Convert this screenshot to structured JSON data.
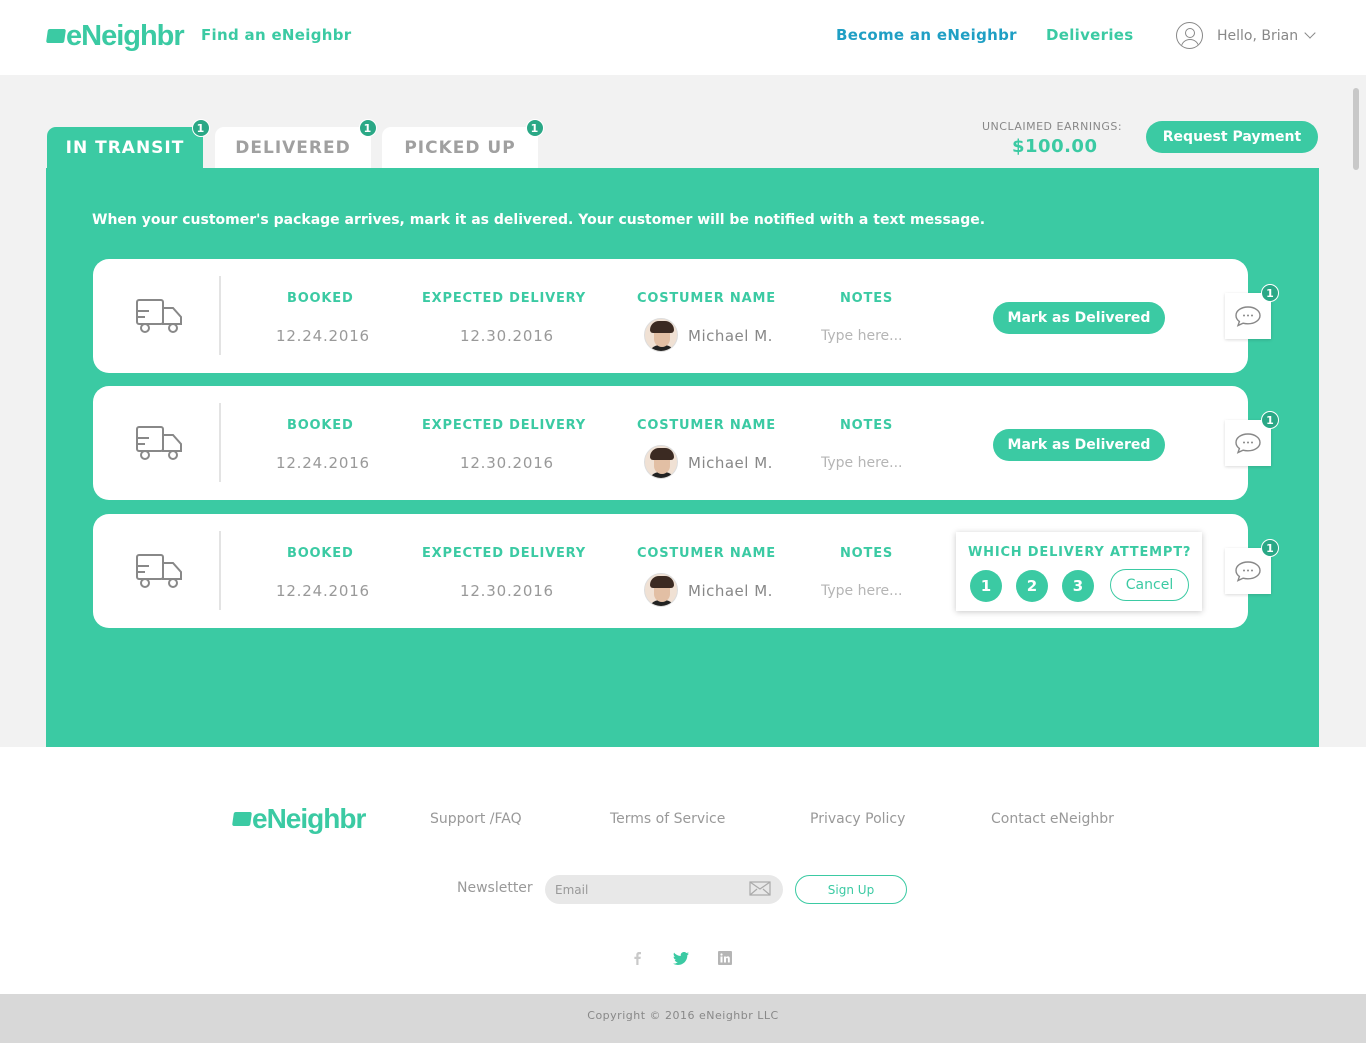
{
  "header": {
    "logo_text": "eNeighbr",
    "nav": {
      "find": "Find an eNeighbr",
      "become": "Become an eNeighbr",
      "deliveries": "Deliveries"
    },
    "user_greeting": "Hello, Brian"
  },
  "tabs": [
    {
      "label": "IN TRANSIT",
      "badge": "1",
      "active": true
    },
    {
      "label": "DELIVERED",
      "badge": "1",
      "active": false
    },
    {
      "label": "PICKED UP",
      "badge": "1",
      "active": false
    }
  ],
  "earnings": {
    "label": "UNCLAIMED EARNINGS:",
    "value": "$100.00",
    "request_button": "Request Payment"
  },
  "panel": {
    "message": "When your customer's package arrives, mark it as delivered. Your customer will be notified with a text message.",
    "columns": {
      "booked": "BOOKED",
      "expected": "EXPECTED DELIVERY",
      "customer": "COSTUMER NAME",
      "notes": "NOTES"
    },
    "notes_placeholder": "Type here...",
    "mark_button": "Mark as Delivered",
    "deliveries": [
      {
        "booked": "12.24.2016",
        "expected": "12.30.2016",
        "customer": "Michael M.",
        "chat_badge": "1"
      },
      {
        "booked": "12.24.2016",
        "expected": "12.30.2016",
        "customer": "Michael M.",
        "chat_badge": "1"
      },
      {
        "booked": "12.24.2016",
        "expected": "12.30.2016",
        "customer": "Michael M.",
        "chat_badge": "1"
      }
    ],
    "attempt_popup": {
      "title": "WHICH DELIVERY ATTEMPT?",
      "options": [
        "1",
        "2",
        "3"
      ],
      "cancel": "Cancel"
    }
  },
  "footer": {
    "logo_text": "eNeighbr",
    "links": {
      "support": "Support /FAQ",
      "terms": "Terms of Service",
      "privacy": "Privacy Policy",
      "contact": "Contact eNeighbr"
    },
    "newsletter_label": "Newsletter",
    "email_placeholder": "Email",
    "signup": "Sign Up",
    "social_icons": [
      "facebook-icon",
      "twitter-icon",
      "linkedin-icon"
    ],
    "copyright": "Copyright © 2016 eNeighbr LLC"
  },
  "colors": {
    "accent": "#3bcaa3",
    "link_blue": "#1f9fc4",
    "badge": "#2aa886"
  }
}
